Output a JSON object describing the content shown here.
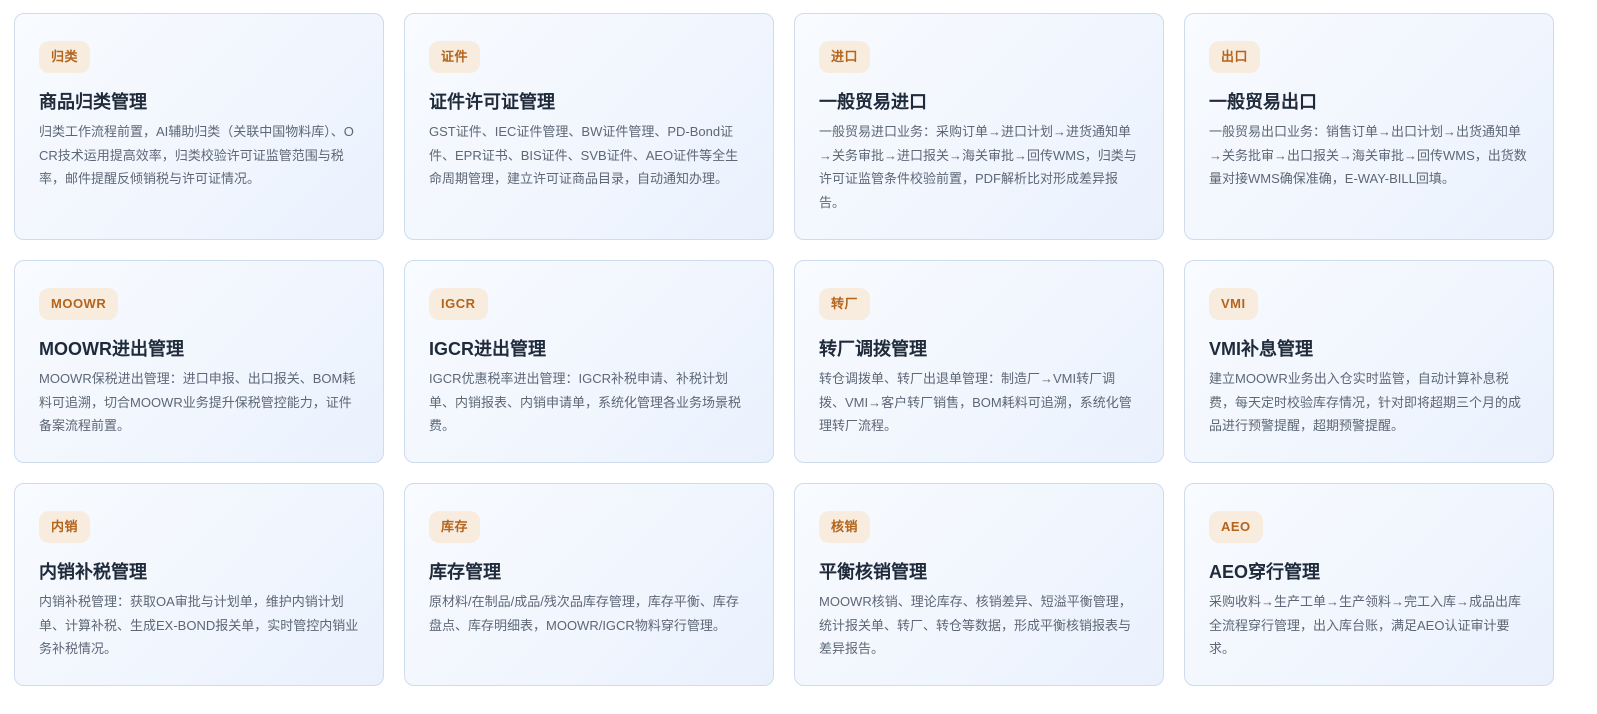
{
  "cards": [
    {
      "tag": "归类",
      "title": "商品归类管理",
      "desc": "归类工作流程前置，AI辅助归类（关联中国物料库）、OCR技术运用提高效率，归类校验许可证监管范围与税率，邮件提醒反倾销税与许可证情况。"
    },
    {
      "tag": "证件",
      "title": "证件许可证管理",
      "desc": "GST证件、IEC证件管理、BW证件管理、PD-Bond证件、EPR证书、BIS证件、SVB证件、AEO证件等全生命周期管理，建立许可证商品目录，自动通知办理。"
    },
    {
      "tag": "进口",
      "title": "一般贸易进口",
      "desc": "一般贸易进口业务：采购订单→进口计划→进货通知单→关务审批→进口报关→海关审批→回传WMS，归类与许可证监管条件校验前置，PDF解析比对形成差异报告。"
    },
    {
      "tag": "出口",
      "title": "一般贸易出口",
      "desc": "一般贸易出口业务：销售订单→出口计划→出货通知单→关务批审→出口报关→海关审批→回传WMS，出货数量对接WMS确保准确，E-WAY-BILL回填。"
    },
    {
      "tag": "MOOWR",
      "title": "MOOWR进出管理",
      "desc": "MOOWR保税进出管理：进口申报、出口报关、BOM耗料可追溯，切合MOOWR业务提升保税管控能力，证件备案流程前置。"
    },
    {
      "tag": "IGCR",
      "title": "IGCR进出管理",
      "desc": "IGCR优惠税率进出管理：IGCR补税申请、补税计划单、内销报表、内销申请单，系统化管理各业务场景税费。"
    },
    {
      "tag": "转厂",
      "title": "转厂调拨管理",
      "desc": "转仓调拨单、转厂出退单管理：制造厂→VMI转厂调拨、VMI→客户转厂销售，BOM耗料可追溯，系统化管理转厂流程。"
    },
    {
      "tag": "VMI",
      "title": "VMI补息管理",
      "desc": "建立MOOWR业务出入仓实时监管，自动计算补息税费，每天定时校验库存情况，针对即将超期三个月的成品进行预警提醒，超期预警提醒。"
    },
    {
      "tag": "内销",
      "title": "内销补税管理",
      "desc": "内销补税管理：获取OA审批与计划单，维护内销计划单、计算补税、生成EX-BOND报关单，实时管控内销业务补税情况。"
    },
    {
      "tag": "库存",
      "title": "库存管理",
      "desc": "原材料/在制品/成品/残次品库存管理，库存平衡、库存盘点、库存明细表，MOOWR/IGCR物料穿行管理。"
    },
    {
      "tag": "核销",
      "title": "平衡核销管理",
      "desc": "MOOWR核销、理论库存、核销差异、短溢平衡管理，统计报关单、转厂、转仓等数据，形成平衡核销报表与差异报告。"
    },
    {
      "tag": "AEO",
      "title": "AEO穿行管理",
      "desc": "采购收料→生产工单→生产领料→完工入库→成品出库全流程穿行管理，出入库台账，满足AEO认证审计要求。"
    }
  ]
}
